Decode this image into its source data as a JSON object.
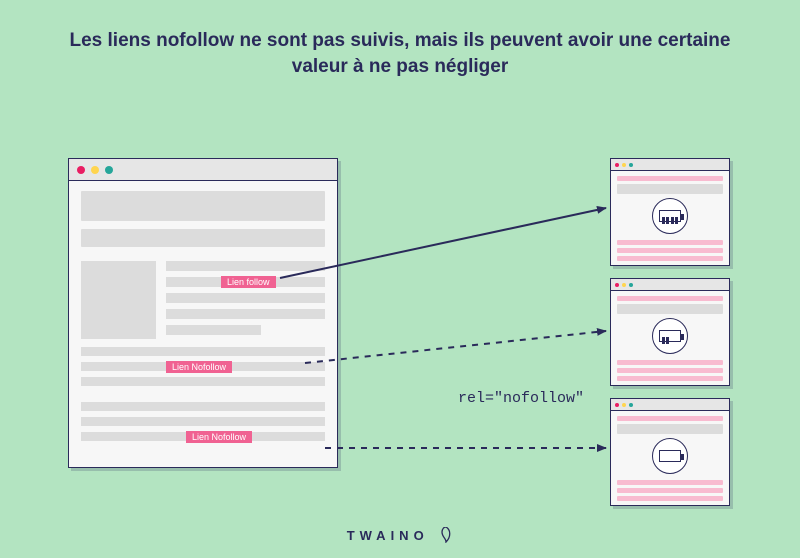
{
  "title": "Les liens nofollow ne sont pas suivis, mais ils peuvent avoir une certaine valeur à ne pas négliger",
  "labels": {
    "follow": "Lien follow",
    "nofollow1": "Lien Nofollow",
    "nofollow2": "Lien Nofollow",
    "rel": "rel=\"nofollow\""
  },
  "targets": {
    "full": {
      "battery_level": 4
    },
    "half": {
      "battery_level": 2
    },
    "empty": {
      "battery_level": 0
    }
  },
  "brand": "TWAINO",
  "colors": {
    "bg": "#b3e4c1",
    "navy": "#2a2a5a",
    "pink": "#f06292",
    "pink_light": "#f8bbd0",
    "gray": "#dcdcdc"
  }
}
